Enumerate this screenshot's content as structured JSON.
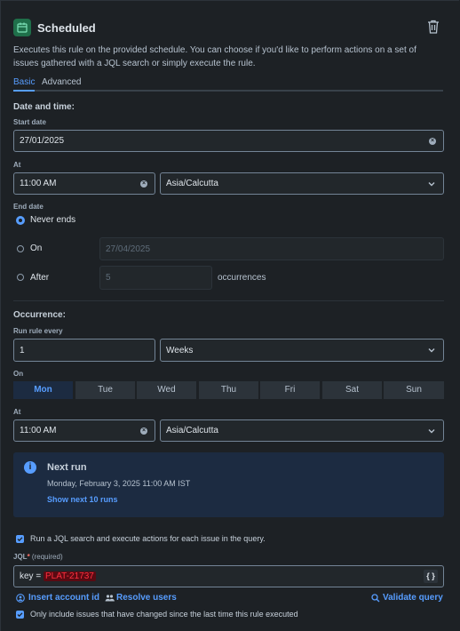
{
  "header": {
    "title": "Scheduled",
    "icon": "calendar-icon",
    "delete_icon": "trash-icon"
  },
  "description": "Executes this rule on the provided schedule. You can choose if you'd like to perform actions on a set of issues gathered with a JQL search or simply execute the rule.",
  "tabs": [
    {
      "label": "Basic",
      "active": true
    },
    {
      "label": "Advanced",
      "active": false
    }
  ],
  "date_time": {
    "section": "Date and time:",
    "start_date_label": "Start date",
    "start_date": "27/01/2025",
    "at_label": "At",
    "at_time": "11:00 AM",
    "timezone": "Asia/Calcutta",
    "end_date_label": "End date",
    "options": [
      {
        "label": "Never ends",
        "selected": true
      },
      {
        "label": "On",
        "selected": false,
        "value": "27/04/2025"
      },
      {
        "label": "After",
        "selected": false,
        "value": "5",
        "suffix": "occurrences"
      }
    ]
  },
  "occurrence": {
    "section": "Occurrence:",
    "run_every_label": "Run rule every",
    "run_every_value": "1",
    "unit": "Weeks",
    "on_label": "On",
    "days": [
      {
        "label": "Mon",
        "active": true
      },
      {
        "label": "Tue",
        "active": false
      },
      {
        "label": "Wed",
        "active": false
      },
      {
        "label": "Thu",
        "active": false
      },
      {
        "label": "Fri",
        "active": false
      },
      {
        "label": "Sat",
        "active": false
      },
      {
        "label": "Sun",
        "active": false
      }
    ],
    "at_label": "At",
    "at_time": "11:00 AM",
    "timezone": "Asia/Calcutta"
  },
  "next_run": {
    "title": "Next run",
    "datetime": "Monday, February 3, 2025 11:00 AM IST",
    "link": "Show next 10 runs"
  },
  "jql": {
    "run_jql_label": "Run a JQL search and execute actions for each issue in the query.",
    "run_jql_checked": true,
    "label": "JQL",
    "required_mark": "*",
    "required_text": "(required)",
    "query_prefix": "key = ",
    "query_redacted": "PLAT-21737",
    "format_button": "{ }",
    "insert_account": "Insert account id",
    "resolve_users": "Resolve users",
    "validate": "Validate query",
    "only_changed_label": "Only include issues that have changed since the last time this rule executed",
    "only_changed_checked": true
  },
  "colors": {
    "accent": "#579dff",
    "background": "#1d2125",
    "field": "#22272b",
    "info_bg": "#1c2b41"
  }
}
